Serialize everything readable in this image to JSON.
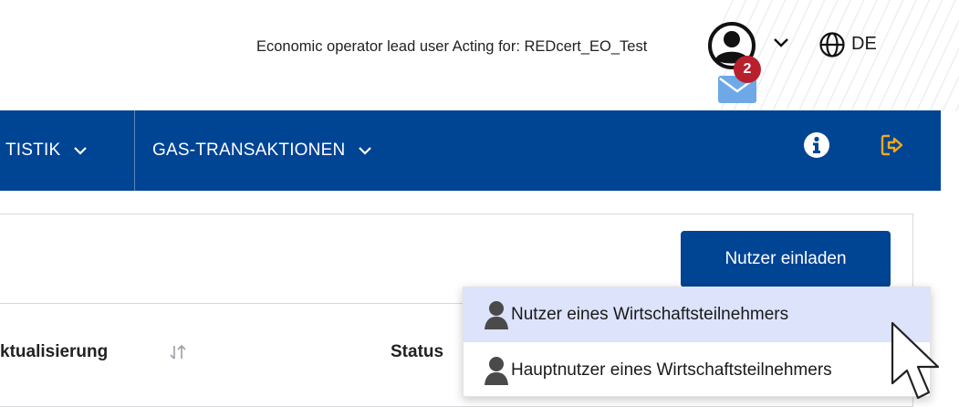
{
  "header": {
    "user_role": "Economic operator lead user Acting for: REDcert_EO_Test",
    "notification_count": "2",
    "language": "DE"
  },
  "navbar": {
    "items": [
      {
        "label": "TISTIK"
      },
      {
        "label": "GAS-TRANSAKTIONEN"
      }
    ],
    "icons": [
      "info-icon",
      "logout-icon"
    ],
    "background_color": "#004494"
  },
  "main": {
    "invite_button_label": "Nutzer einladen",
    "columns": [
      {
        "label": "ktualisierung"
      },
      {
        "label": "Status"
      }
    ]
  },
  "dropdown": {
    "items": [
      {
        "label": "Nutzer eines Wirtschaftsteilnehmers",
        "highlighted": true
      },
      {
        "label": "Hauptnutzer eines Wirtschaftsteilnehmers",
        "highlighted": false
      }
    ]
  },
  "colors": {
    "primary": "#004494",
    "badge": "#b8202e",
    "highlight": "#dce3fb",
    "mail": "#6ea8e6"
  }
}
